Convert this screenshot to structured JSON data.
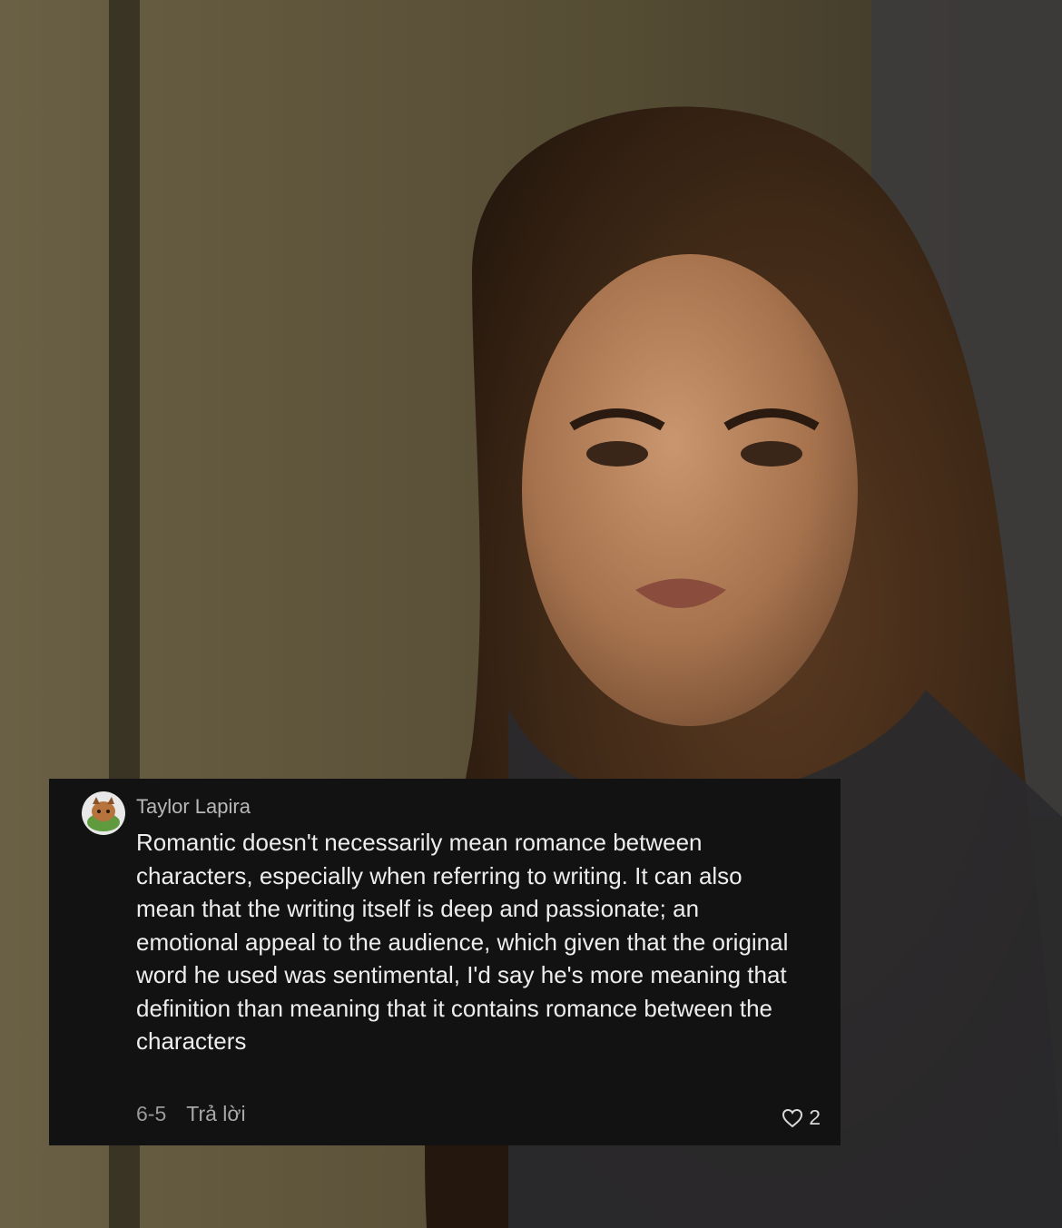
{
  "comment": {
    "username": "Taylor Lapira",
    "text": "Romantic doesn't necessarily mean romance between characters, especially when referring to writing. It can also mean that the writing itself is deep and passionate; an emotional appeal to the audience, which given that the original word he used was sentimental, I'd say he's more meaning that definition than meaning that it contains romance between the characters",
    "date": "6-5",
    "reply_label": "Trả lời",
    "like_count": "2"
  },
  "icons": {
    "avatar": "user-avatar-icon",
    "like": "heart-outline-icon"
  },
  "colors": {
    "card_background": "#121212",
    "text_primary": "#ededed",
    "text_secondary": "#9a9a9a"
  }
}
